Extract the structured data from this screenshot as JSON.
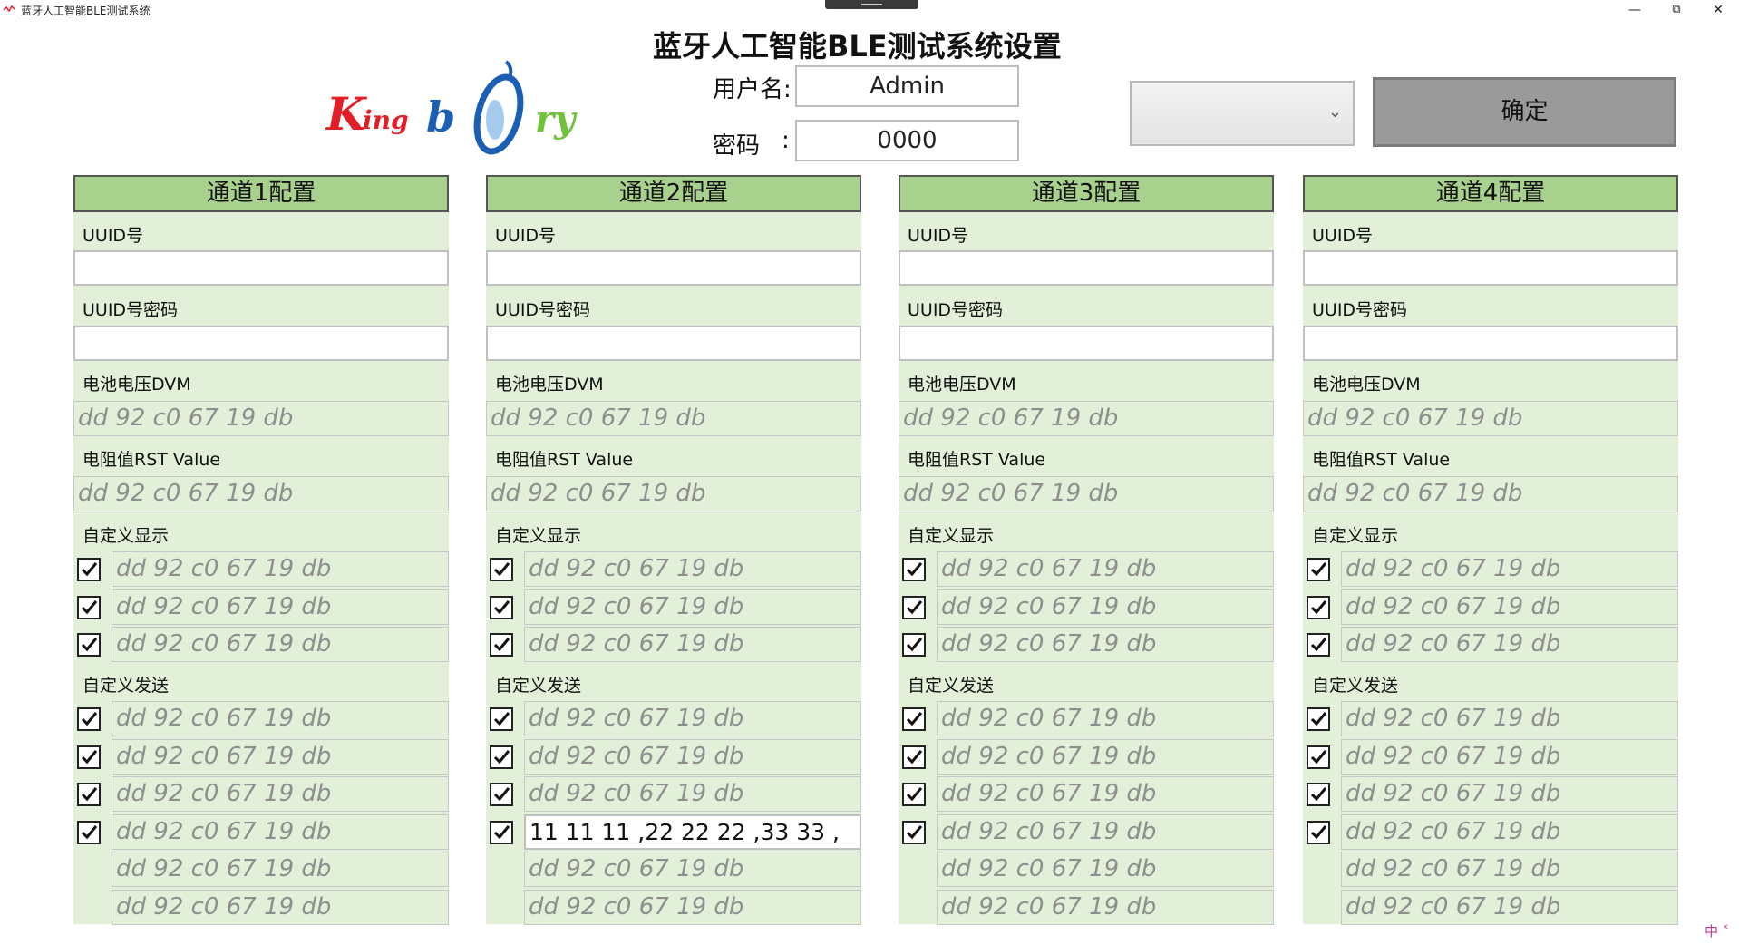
{
  "window": {
    "title": "蓝牙人工智能BLE测试系统",
    "minimize": "—",
    "restore": "⧉",
    "close": "✕"
  },
  "header": {
    "title": "蓝牙人工智能BLE测试系统设置",
    "logo": "Kingbory",
    "username_label": "用户名:",
    "username_value": "Admin",
    "password_label": "密码",
    "password_colon": ":",
    "password_value": "0000",
    "combo_value": "",
    "confirm_label": "确定"
  },
  "panels": [
    {
      "title": "通道1配置",
      "uuid_label": "UUID号",
      "uuid_value": "",
      "uuid_pwd_label": "UUID号密码",
      "uuid_pwd_value": "",
      "battery_label": "电池电压DVM",
      "battery_placeholder": "dd 92 c0 67 19 db",
      "rst_label": "电阻值RST Value",
      "rst_placeholder": "dd 92 c0 67 19 db",
      "display_label": "自定义显示",
      "display_rows": [
        {
          "checked": true,
          "placeholder": "dd 92 c0 67 19 db",
          "value": ""
        },
        {
          "checked": true,
          "placeholder": "dd 92 c0 67 19 db",
          "value": ""
        },
        {
          "checked": true,
          "placeholder": "dd 92 c0 67 19 db",
          "value": ""
        }
      ],
      "send_label": "自定义发送",
      "send_rows": [
        {
          "checked": true,
          "placeholder": "dd 92 c0 67 19 db",
          "value": ""
        },
        {
          "checked": true,
          "placeholder": "dd 92 c0 67 19 db",
          "value": ""
        },
        {
          "checked": true,
          "placeholder": "dd 92 c0 67 19 db",
          "value": ""
        },
        {
          "checked": true,
          "placeholder": "dd 92 c0 67 19 db",
          "value": ""
        }
      ],
      "extra_rows": [
        {
          "placeholder": "dd 92 c0 67 19 db"
        },
        {
          "placeholder": "dd 92 c0 67 19 db"
        }
      ]
    },
    {
      "title": "通道2配置",
      "uuid_label": "UUID号",
      "uuid_value": "",
      "uuid_pwd_label": "UUID号密码",
      "uuid_pwd_value": "",
      "battery_label": "电池电压DVM",
      "battery_placeholder": "dd 92 c0 67 19 db",
      "rst_label": "电阻值RST Value",
      "rst_placeholder": "dd 92 c0 67 19 db",
      "display_label": "自定义显示",
      "display_rows": [
        {
          "checked": true,
          "placeholder": "dd 92 c0 67 19 db",
          "value": ""
        },
        {
          "checked": true,
          "placeholder": "dd 92 c0 67 19 db",
          "value": ""
        },
        {
          "checked": true,
          "placeholder": "dd 92 c0 67 19 db",
          "value": ""
        }
      ],
      "send_label": "自定义发送",
      "send_rows": [
        {
          "checked": true,
          "placeholder": "dd 92 c0 67 19 db",
          "value": ""
        },
        {
          "checked": true,
          "placeholder": "dd 92 c0 67 19 db",
          "value": ""
        },
        {
          "checked": true,
          "placeholder": "dd 92 c0 67 19 db",
          "value": ""
        },
        {
          "checked": true,
          "placeholder": "dd 92 c0 67 19 db",
          "value": "11 11 11 ,22 22 22 ,33 33 ,"
        }
      ],
      "extra_rows": [
        {
          "placeholder": "dd 92 c0 67 19 db"
        },
        {
          "placeholder": "dd 92 c0 67 19 db"
        }
      ]
    },
    {
      "title": "通道3配置",
      "uuid_label": "UUID号",
      "uuid_value": "",
      "uuid_pwd_label": "UUID号密码",
      "uuid_pwd_value": "",
      "battery_label": "电池电压DVM",
      "battery_placeholder": "dd 92 c0 67 19 db",
      "rst_label": "电阻值RST Value",
      "rst_placeholder": "dd 92 c0 67 19 db",
      "display_label": "自定义显示",
      "display_rows": [
        {
          "checked": true,
          "placeholder": "dd 92 c0 67 19 db",
          "value": ""
        },
        {
          "checked": true,
          "placeholder": "dd 92 c0 67 19 db",
          "value": ""
        },
        {
          "checked": true,
          "placeholder": "dd 92 c0 67 19 db",
          "value": ""
        }
      ],
      "send_label": "自定义发送",
      "send_rows": [
        {
          "checked": true,
          "placeholder": "dd 92 c0 67 19 db",
          "value": ""
        },
        {
          "checked": true,
          "placeholder": "dd 92 c0 67 19 db",
          "value": ""
        },
        {
          "checked": true,
          "placeholder": "dd 92 c0 67 19 db",
          "value": ""
        },
        {
          "checked": true,
          "placeholder": "dd 92 c0 67 19 db",
          "value": ""
        }
      ],
      "extra_rows": [
        {
          "placeholder": "dd 92 c0 67 19 db"
        },
        {
          "placeholder": "dd 92 c0 67 19 db"
        }
      ]
    },
    {
      "title": "通道4配置",
      "uuid_label": "UUID号",
      "uuid_value": "",
      "uuid_pwd_label": "UUID号密码",
      "uuid_pwd_value": "",
      "battery_label": "电池电压DVM",
      "battery_placeholder": "dd 92 c0 67 19 db",
      "rst_label": "电阻值RST Value",
      "rst_placeholder": "dd 92 c0 67 19 db",
      "display_label": "自定义显示",
      "display_rows": [
        {
          "checked": true,
          "placeholder": "dd 92 c0 67 19 db",
          "value": ""
        },
        {
          "checked": true,
          "placeholder": "dd 92 c0 67 19 db",
          "value": ""
        },
        {
          "checked": true,
          "placeholder": "dd 92 c0 67 19 db",
          "value": ""
        }
      ],
      "send_label": "自定义发送",
      "send_rows": [
        {
          "checked": true,
          "placeholder": "dd 92 c0 67 19 db",
          "value": ""
        },
        {
          "checked": true,
          "placeholder": "dd 92 c0 67 19 db",
          "value": ""
        },
        {
          "checked": true,
          "placeholder": "dd 92 c0 67 19 db",
          "value": ""
        },
        {
          "checked": true,
          "placeholder": "dd 92 c0 67 19 db",
          "value": ""
        }
      ],
      "extra_rows": [
        {
          "placeholder": "dd 92 c0 67 19 db"
        },
        {
          "placeholder": "dd 92 c0 67 19 db"
        }
      ]
    }
  ],
  "ime_indicator": "中 ˂",
  "colors": {
    "panel_header": "#a9d18e",
    "panel_body": "#e2f0d9",
    "confirm_button": "#9a9a9a",
    "logo_red": "#e41e26",
    "logo_blue": "#1b5fb5",
    "logo_green": "#6fc13a"
  },
  "icons": {
    "checkbox_check": "check-icon",
    "combo_arrow": "chevron-down-icon",
    "app": "app-icon"
  }
}
